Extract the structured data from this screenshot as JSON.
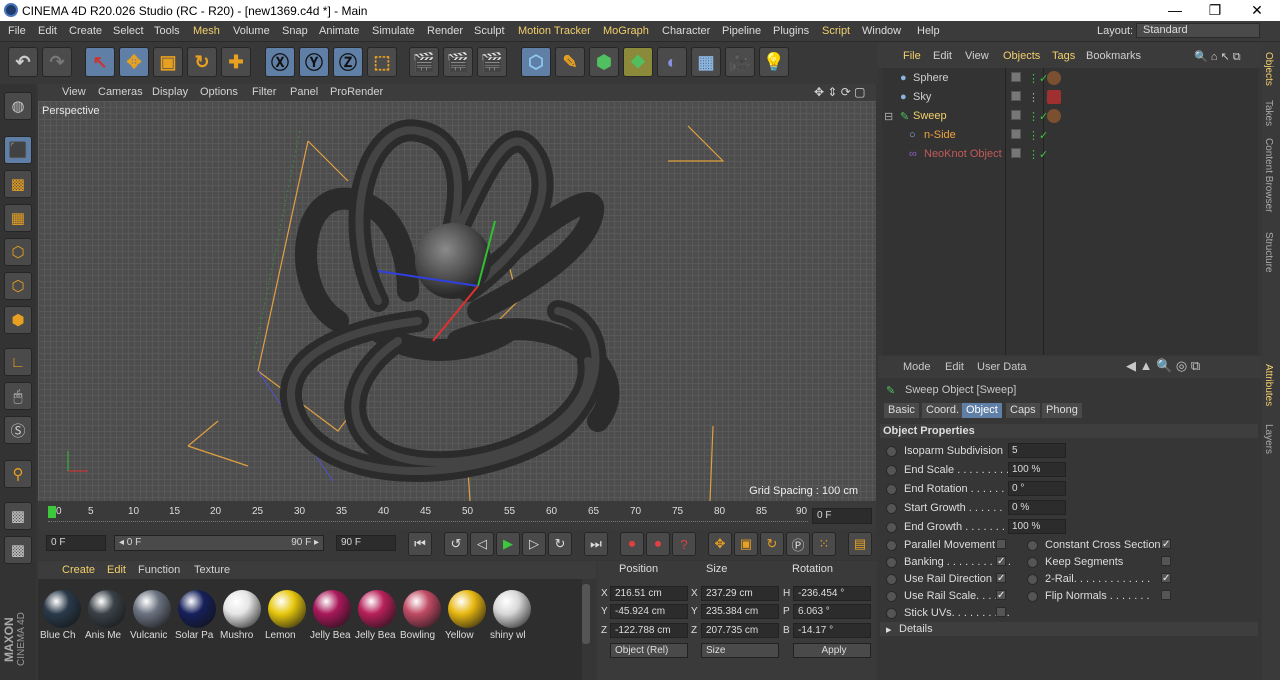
{
  "window": {
    "title": "CINEMA 4D R20.026 Studio (RC - R20) - [new1369.c4d *] - Main",
    "minimize": "—",
    "maximize": "❐",
    "close": "✕"
  },
  "menubar": {
    "items": [
      "File",
      "Edit",
      "Create",
      "Select",
      "Tools",
      "Mesh",
      "Volume",
      "Snap",
      "Animate",
      "Simulate",
      "Render",
      "Sculpt",
      "Motion Tracker",
      "MoGraph",
      "Character",
      "Pipeline",
      "Plugins",
      "Script",
      "Window",
      "Help"
    ],
    "layout_label": "Layout:",
    "layout_value": "Standard"
  },
  "viewport": {
    "menu": [
      "View",
      "Cameras",
      "Display",
      "Options",
      "Filter",
      "Panel",
      "ProRender"
    ],
    "label": "Perspective",
    "grid_spacing": "Grid Spacing : 100 cm"
  },
  "timeline": {
    "ticks": [
      "0",
      "5",
      "10",
      "15",
      "20",
      "25",
      "30",
      "35",
      "40",
      "45",
      "50",
      "55",
      "60",
      "65",
      "70",
      "75",
      "80",
      "85",
      "90"
    ],
    "current_frame": "0 F"
  },
  "playback": {
    "start": "0 F",
    "range_start": "◂ 0 F",
    "range_end": "90 F ▸",
    "end": "90 F"
  },
  "materials": {
    "menu": [
      "Create",
      "Edit",
      "Function",
      "Texture"
    ],
    "items": [
      {
        "label": "Blue Ch",
        "color": "#2a3a4a"
      },
      {
        "label": "Anis Me",
        "color": "#3a4148"
      },
      {
        "label": "Vulcanic",
        "color": "#6a7280"
      },
      {
        "label": "Solar Pa",
        "color": "#16205a"
      },
      {
        "label": "Mushro",
        "color": "#e6e6e6"
      },
      {
        "label": "Lemon",
        "color": "#e8c80e"
      },
      {
        "label": "Jelly Bea",
        "color": "#a8185a"
      },
      {
        "label": "Jelly Bea",
        "color": "#b8205a"
      },
      {
        "label": "Bowling",
        "color": "#c04a64"
      },
      {
        "label": "Yellow",
        "color": "#e8b812"
      },
      {
        "label": "shiny wl",
        "color": "#d8d8d8"
      }
    ]
  },
  "coordinates": {
    "headers": [
      "Position",
      "Size",
      "Rotation"
    ],
    "rows": [
      {
        "axis": "X",
        "pos": "216.51 cm",
        "size_axis": "X",
        "size": "237.29 cm",
        "rot_axis": "H",
        "rot": "-236.454 °"
      },
      {
        "axis": "Y",
        "pos": "-45.924 cm",
        "size_axis": "Y",
        "size": "235.384 cm",
        "rot_axis": "P",
        "rot": "6.063 °"
      },
      {
        "axis": "Z",
        "pos": "-122.788 cm",
        "size_axis": "Z",
        "size": "207.735 cm",
        "rot_axis": "B",
        "rot": "-14.17 °"
      }
    ],
    "mode": "Object (Rel)",
    "size_mode": "Size",
    "apply": "Apply"
  },
  "object_manager": {
    "menu": [
      "File",
      "Edit",
      "View",
      "Objects",
      "Tags",
      "Bookmarks"
    ],
    "objects": [
      {
        "name": "Sphere",
        "color": "#d0d0d0",
        "indent": 0
      },
      {
        "name": "Sky",
        "color": "#d0d0d0",
        "indent": 0
      },
      {
        "name": "Sweep",
        "color": "#f2cf6c",
        "indent": 0
      },
      {
        "name": "n-Side",
        "color": "#f2a23c",
        "indent": 1
      },
      {
        "name": "NeoKnot Object",
        "color": "#c45a5a",
        "indent": 1
      }
    ]
  },
  "attributes": {
    "menu": [
      "Mode",
      "Edit",
      "User Data"
    ],
    "title": "Sweep Object [Sweep]",
    "tabs": [
      "Basic",
      "Coord.",
      "Object",
      "Caps",
      "Phong"
    ],
    "active_tab": "Object",
    "section": "Object Properties",
    "fields": [
      {
        "label": "Isoparm Subdivision",
        "value": "5"
      },
      {
        "label": "End Scale . . . . . . . . . .",
        "value": "100 %"
      },
      {
        "label": "End Rotation . . . . . . .",
        "value": "0 °"
      },
      {
        "label": "Start Growth . . . . . .",
        "value": "0 %"
      },
      {
        "label": "End Growth . . . . . . . .",
        "value": "100 %"
      }
    ],
    "checks_left": [
      {
        "label": "Parallel Movement",
        "checked": false
      },
      {
        "label": "Banking . . . . . . . . . . .",
        "checked": true
      },
      {
        "label": "Use Rail Direction",
        "checked": true
      },
      {
        "label": "Use Rail Scale. . . . .",
        "checked": true
      },
      {
        "label": "Stick UVs. . . . . . . . . .",
        "checked": false
      }
    ],
    "checks_right": [
      {
        "label": "Constant Cross Section",
        "checked": true
      },
      {
        "label": "Keep Segments",
        "checked": false
      },
      {
        "label": "2-Rail. . . . . . . . . . . . .",
        "checked": true
      },
      {
        "label": "Flip Normals . . . . . . .",
        "checked": false
      }
    ],
    "details": "Details"
  },
  "side_tabs": [
    "Objects",
    "Takes",
    "Content Browser",
    "Structure",
    "Attributes",
    "Layers"
  ],
  "brand": {
    "line1": "MAXON",
    "line2": "CINEMA 4D"
  }
}
